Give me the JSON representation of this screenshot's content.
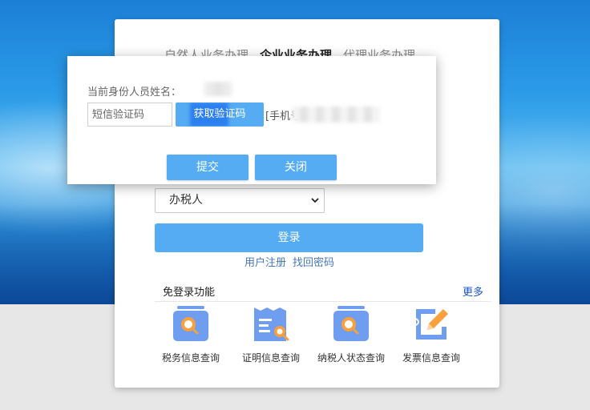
{
  "background": {
    "accent": "#1c7fd6"
  },
  "login": {
    "tabs": [
      {
        "label": "自然人业务办理",
        "active": false
      },
      {
        "label": "企业业务办理",
        "active": true
      },
      {
        "label": "代理业务办理",
        "active": false
      }
    ],
    "role_select": {
      "selected": "办税人"
    },
    "login_button": "登录",
    "register_link": "用户注册",
    "recover_link": "找回密码",
    "free_login_title": "免登录功能",
    "more_link": "更多",
    "functions": [
      {
        "label": "税务信息查询",
        "icon": "magnifier-card-icon"
      },
      {
        "label": "证明信息查询",
        "icon": "certificate-search-icon"
      },
      {
        "label": "纳税人状态查询",
        "icon": "magnifier-card-icon"
      },
      {
        "label": "发票信息查询",
        "icon": "invoice-pencil-icon"
      }
    ]
  },
  "dialog": {
    "name_label": "当前身份人员姓名：",
    "sms_placeholder": "短信验证码",
    "get_code_button": "获取验证码",
    "phone_label": "[手机号",
    "submit_button": "提交",
    "close_button": "关闭"
  },
  "colors": {
    "button_blue": "#56acf2",
    "link_blue": "#4778b8",
    "more_blue": "#1a56c9"
  }
}
